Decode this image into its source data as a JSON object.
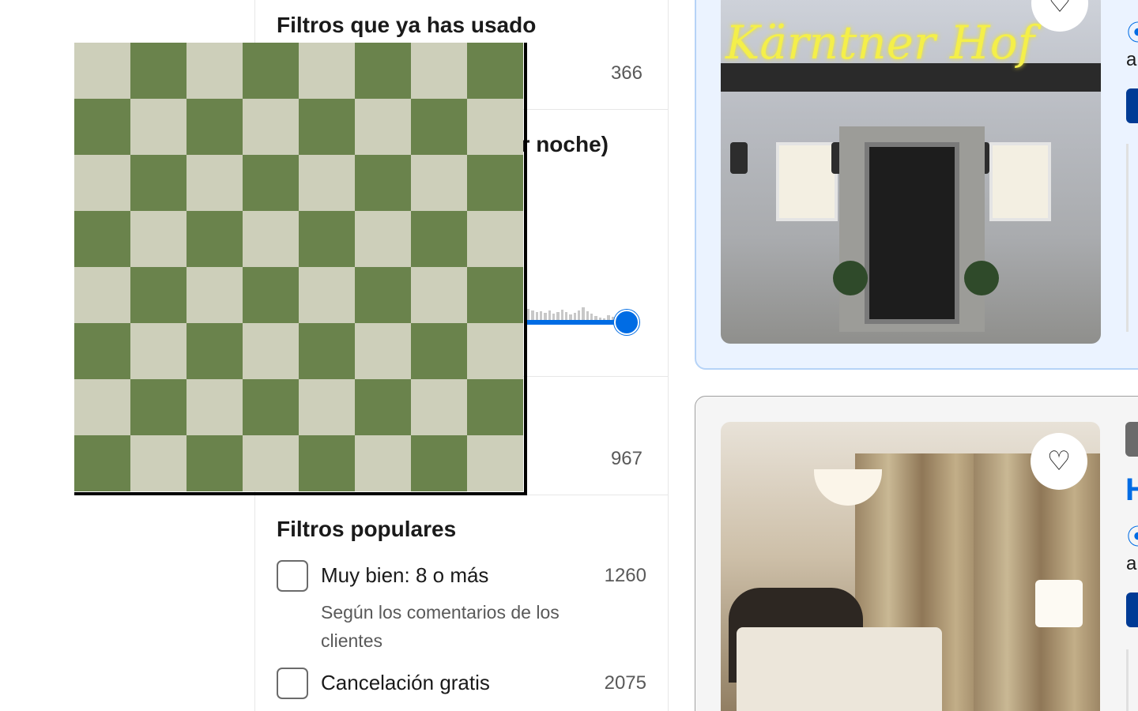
{
  "sidebar": {
    "used_filters": {
      "title": "Filtros que ya has usado",
      "count": "366"
    },
    "budget": {
      "title": "(por noche)"
    },
    "third": {
      "count": "967"
    },
    "popular": {
      "title": "Filtros populares",
      "items": [
        {
          "label": "Muy bien: 8 o más",
          "sub": "Según los comentarios de los clientes",
          "count": "1260"
        },
        {
          "label": "Cancelación gratis",
          "count": "2075"
        }
      ]
    }
  },
  "cards": [
    {
      "sign_text": "Kärntner Hof",
      "heart_icon": "heart-icon"
    },
    {
      "heart_icon": "heart-icon"
    }
  ],
  "fragments": {
    "a1": "a",
    "a2": "a"
  },
  "colors": {
    "accent": "#006ce4",
    "board_light": "#cdcfba",
    "board_dark": "#6a834c"
  }
}
